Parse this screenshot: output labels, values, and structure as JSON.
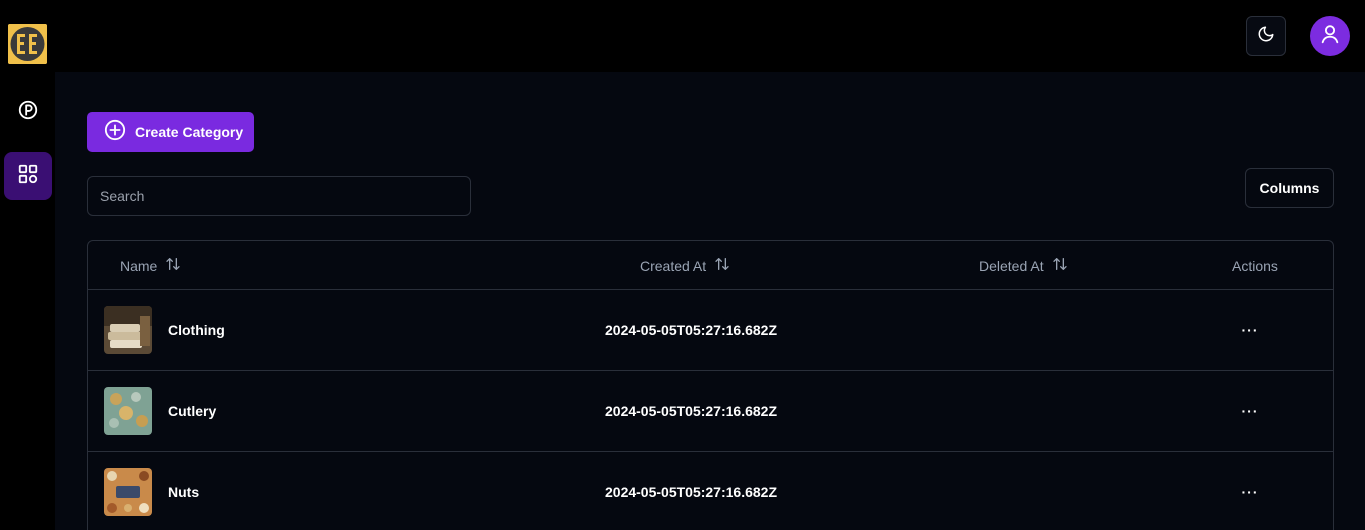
{
  "header": {
    "logo_text": "EE",
    "theme_icon": "moon-icon",
    "avatar_icon": "user-icon"
  },
  "sidebar": {
    "items": [
      {
        "icon": "parking-icon",
        "active": false
      },
      {
        "icon": "grid-icon",
        "active": true
      }
    ]
  },
  "toolbar": {
    "create_label": "Create Category",
    "search_placeholder": "Search",
    "columns_label": "Columns"
  },
  "table": {
    "columns": [
      {
        "label": "Name",
        "sortable": true
      },
      {
        "label": "Created At",
        "sortable": true
      },
      {
        "label": "Deleted At",
        "sortable": true
      },
      {
        "label": "Actions",
        "sortable": false
      }
    ],
    "rows": [
      {
        "name": "Clothing",
        "created_at": "2024-05-05T05:27:16.682Z",
        "deleted_at": "",
        "actions": "···"
      },
      {
        "name": "Cutlery",
        "created_at": "2024-05-05T05:27:16.682Z",
        "deleted_at": "",
        "actions": "···"
      },
      {
        "name": "Nuts",
        "created_at": "2024-05-05T05:27:16.682Z",
        "deleted_at": "",
        "actions": "···"
      }
    ]
  },
  "colors": {
    "accent": "#7a2ae0",
    "avatar": "#7c2ce0",
    "active_nav": "#3a0f73",
    "background": "#050810",
    "border": "#2a2f3a",
    "logo_bg": "#f0c04a"
  }
}
